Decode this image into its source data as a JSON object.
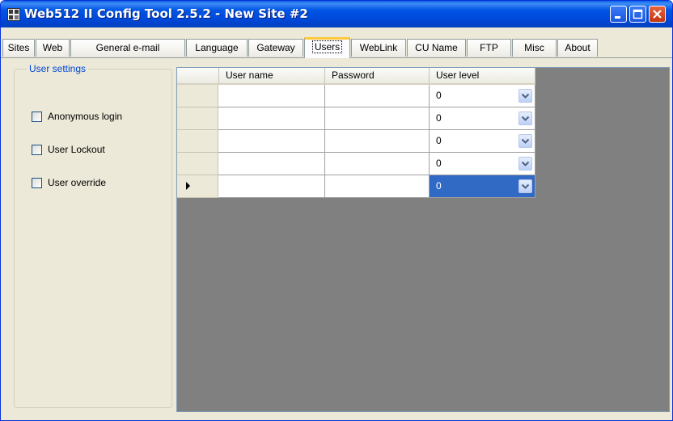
{
  "window": {
    "title": "Web512 II Config Tool 2.5.2 - New Site #2"
  },
  "tabs": [
    "Sites",
    "Web",
    "General e-mail",
    "Language",
    "Gateway",
    "Users",
    "WebLink",
    "CU Name",
    "FTP",
    "Misc",
    "About"
  ],
  "active_tab": "Users",
  "user_settings": {
    "title": "User settings",
    "options": [
      {
        "label": "Anonymous login",
        "checked": false
      },
      {
        "label": "User Lockout",
        "checked": false
      },
      {
        "label": "User override",
        "checked": false
      }
    ]
  },
  "grid": {
    "columns": [
      "User name",
      "Password",
      "User level"
    ],
    "rows": [
      {
        "user_name": "",
        "password": "",
        "user_level": "0"
      },
      {
        "user_name": "",
        "password": "",
        "user_level": "0"
      },
      {
        "user_name": "",
        "password": "",
        "user_level": "0"
      },
      {
        "user_name": "",
        "password": "",
        "user_level": "0"
      },
      {
        "user_name": "",
        "password": "",
        "user_level": "0"
      }
    ],
    "current_row": 5
  },
  "icons": {
    "app": "app-icon",
    "minimize": "minimize-icon",
    "maximize": "maximize-icon",
    "close": "close-icon",
    "dropdown": "chevron-down-icon",
    "row_pointer": "row-pointer-icon"
  }
}
